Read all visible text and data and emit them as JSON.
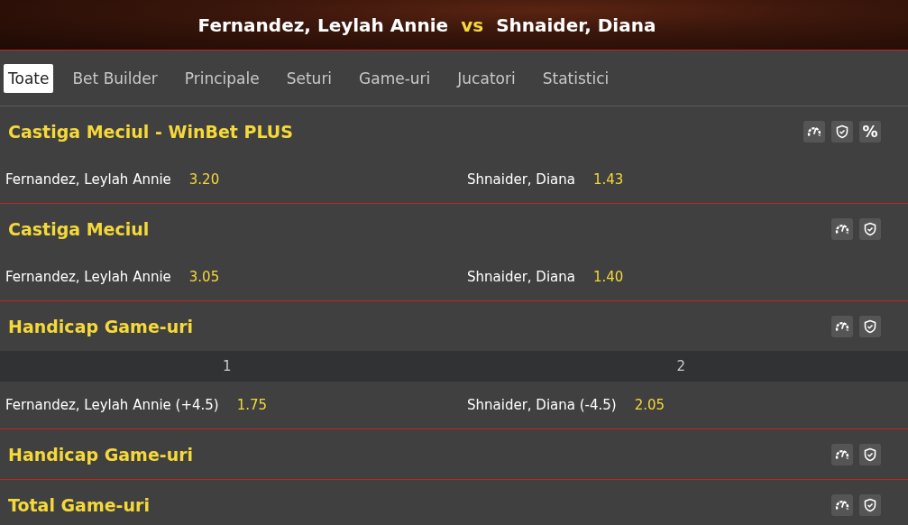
{
  "match": {
    "home": "Fernandez, Leylah Annie",
    "vs": "vs",
    "away": "Shnaider, Diana"
  },
  "tabs": [
    {
      "label": "Toate",
      "selected": true
    },
    {
      "label": "Bet Builder",
      "selected": false
    },
    {
      "label": "Principale",
      "selected": false
    },
    {
      "label": "Seturi",
      "selected": false
    },
    {
      "label": "Game-uri",
      "selected": false
    },
    {
      "label": "Jucatori",
      "selected": false
    },
    {
      "label": "Statistici",
      "selected": false
    }
  ],
  "markets": [
    {
      "title": "Castiga Meciul - WinBet PLUS",
      "icons": [
        {
          "kind": "gauge"
        },
        {
          "kind": "shield"
        },
        {
          "kind": "text",
          "text": "%"
        }
      ],
      "outcomes": [
        {
          "name": "Fernandez, Leylah Annie",
          "odds": "3.20"
        },
        {
          "name": "Shnaider, Diana",
          "odds": "1.43"
        }
      ]
    },
    {
      "title": "Castiga Meciul",
      "icons": [
        {
          "kind": "gauge"
        },
        {
          "kind": "shield"
        }
      ],
      "outcomes": [
        {
          "name": "Fernandez, Leylah Annie",
          "odds": "3.05"
        },
        {
          "name": "Shnaider, Diana",
          "odds": "1.40"
        }
      ]
    },
    {
      "title": "Handicap Game-uri",
      "icons": [
        {
          "kind": "gauge"
        },
        {
          "kind": "shield"
        }
      ],
      "columns": [
        "1",
        "2"
      ],
      "outcomes": [
        {
          "name": "Fernandez, Leylah Annie (+4.5)",
          "odds": "1.75"
        },
        {
          "name": "Shnaider, Diana (-4.5)",
          "odds": "2.05"
        }
      ]
    },
    {
      "title": "Handicap Game-uri",
      "icons": [
        {
          "kind": "gauge"
        },
        {
          "kind": "shield"
        }
      ]
    },
    {
      "title": "Total Game-uri",
      "icons": [
        {
          "kind": "gauge"
        },
        {
          "kind": "shield"
        }
      ]
    }
  ]
}
